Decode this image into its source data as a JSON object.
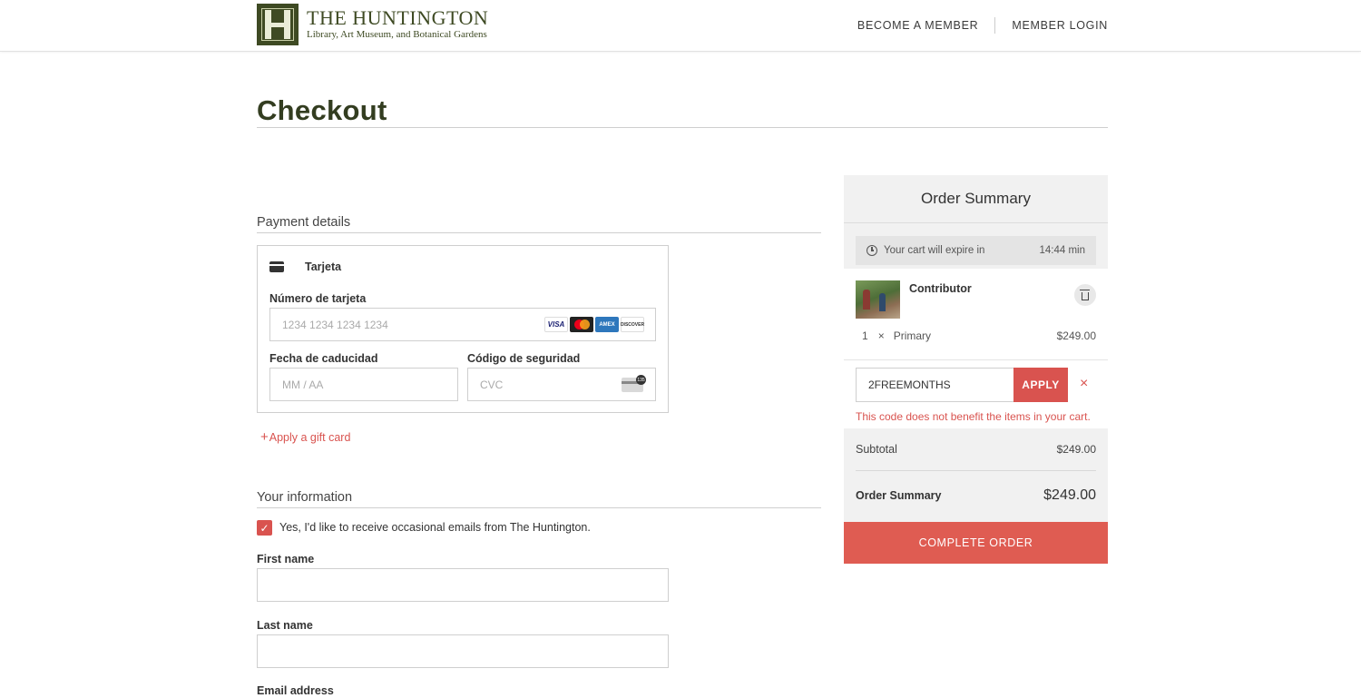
{
  "header": {
    "logo_title": "THE HUNTINGTON",
    "logo_subtitle": "Library, Art Museum, and Botanical Gardens",
    "nav": {
      "become_member": "BECOME A MEMBER",
      "member_login": "MEMBER LOGIN"
    }
  },
  "page_title": "Checkout",
  "payment": {
    "section_title": "Payment details",
    "method_label": "Tarjeta",
    "card_number_label": "Número de tarjeta",
    "card_number_placeholder": "1234 1234 1234 1234",
    "expiry_label": "Fecha de caducidad",
    "expiry_placeholder": "MM / AA",
    "cvc_label": "Código de seguridad",
    "cvc_placeholder": "CVC",
    "brands": [
      "VISA",
      "mastercard",
      "AMEX",
      "DISCOVER"
    ],
    "cvc_icon_text": "135",
    "gift_card_link": "Apply a gift card"
  },
  "info": {
    "section_title": "Your information",
    "email_optin_label": "Yes, I'd like to receive occasional emails from The Huntington.",
    "email_optin_checked": true,
    "first_name_label": "First name",
    "last_name_label": "Last name",
    "email_label": "Email address"
  },
  "summary": {
    "title": "Order Summary",
    "expire_label": "Your cart will expire in",
    "expire_time": "14:44 min",
    "item": {
      "name": "Contributor",
      "quantity": "1",
      "times": "×",
      "type": "Primary",
      "price": "$249.00"
    },
    "promo": {
      "value": "2FREEMONTHS",
      "apply_label": "APPLY",
      "clear_symbol": "×",
      "error": "This code does not benefit the items in your cart."
    },
    "subtotal_label": "Subtotal",
    "subtotal_value": "$249.00",
    "total_label": "Order Summary",
    "total_value": "$249.00",
    "complete_button": "COMPLETE ORDER"
  },
  "colors": {
    "brand_green": "#3e4a23",
    "accent_red": "#d9534f",
    "complete_button": "#df5c52"
  }
}
